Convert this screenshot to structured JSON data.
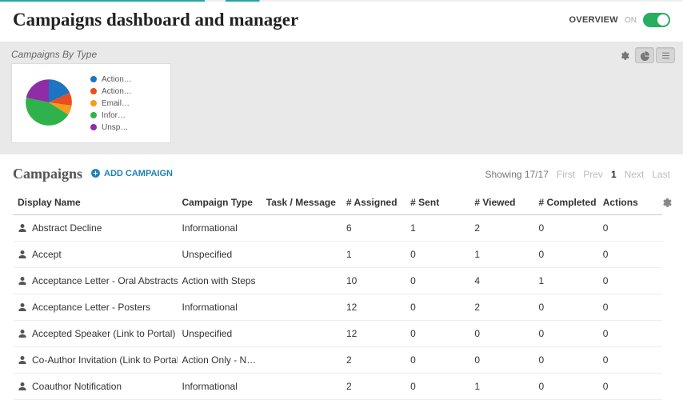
{
  "header": {
    "title": "Campaigns dashboard and manager",
    "overview_label": "OVERVIEW",
    "on_label": "ON"
  },
  "chart": {
    "title": "Campaigns By Type",
    "legend": [
      {
        "label": "Action…",
        "color": "#1e73c2"
      },
      {
        "label": "Action…",
        "color": "#e94e1b"
      },
      {
        "label": "Email…",
        "color": "#f39c1e"
      },
      {
        "label": "Infor…",
        "color": "#2fb24c"
      },
      {
        "label": "Unsp…",
        "color": "#8f2da6"
      }
    ]
  },
  "chart_data": {
    "type": "pie",
    "title": "Campaigns By Type",
    "categories": [
      "Action with Steps",
      "Action Only",
      "Email",
      "Informational",
      "Unspecified"
    ],
    "values": [
      18,
      12,
      6,
      41,
      23
    ],
    "colors": [
      "#1e73c2",
      "#e94e1b",
      "#f39c1e",
      "#2fb24c",
      "#8f2da6"
    ]
  },
  "campaigns": {
    "section_title": "Campaigns",
    "add_label": "ADD CAMPAIGN",
    "showing": "Showing 17/17",
    "pager": {
      "first": "First",
      "prev": "Prev",
      "current": "1",
      "next": "Next",
      "last": "Last"
    },
    "columns": {
      "name": "Display Name",
      "type": "Campaign Type",
      "task": "Task / Message",
      "assigned": "# Assigned",
      "sent": "# Sent",
      "viewed": "# Viewed",
      "completed": "# Completed",
      "actions": "Actions"
    },
    "rows": [
      {
        "name": "Abstract Decline",
        "type": "Informational",
        "task": "",
        "assigned": "6",
        "sent": "1",
        "viewed": "2",
        "completed": "0",
        "actions": "0"
      },
      {
        "name": "Accept",
        "type": "Unspecified",
        "task": "",
        "assigned": "1",
        "sent": "0",
        "viewed": "1",
        "completed": "0",
        "actions": "0"
      },
      {
        "name": "Acceptance Letter - Oral Abstracts",
        "type": "Action with Steps",
        "task": "",
        "assigned": "10",
        "sent": "0",
        "viewed": "4",
        "completed": "1",
        "actions": "0"
      },
      {
        "name": "Acceptance Letter - Posters",
        "type": "Informational",
        "task": "",
        "assigned": "12",
        "sent": "0",
        "viewed": "2",
        "completed": "0",
        "actions": "0"
      },
      {
        "name": "Accepted Speaker (Link to Portal)",
        "type": "Unspecified",
        "task": "",
        "assigned": "12",
        "sent": "0",
        "viewed": "0",
        "completed": "0",
        "actions": "0"
      },
      {
        "name": "Co-Author Invitation (Link to Portal)",
        "type": "Action Only - No St…",
        "task": "",
        "assigned": "2",
        "sent": "0",
        "viewed": "0",
        "completed": "0",
        "actions": "0"
      },
      {
        "name": "Coauthor Notification",
        "type": "Informational",
        "task": "",
        "assigned": "2",
        "sent": "0",
        "viewed": "1",
        "completed": "0",
        "actions": "0"
      }
    ]
  }
}
